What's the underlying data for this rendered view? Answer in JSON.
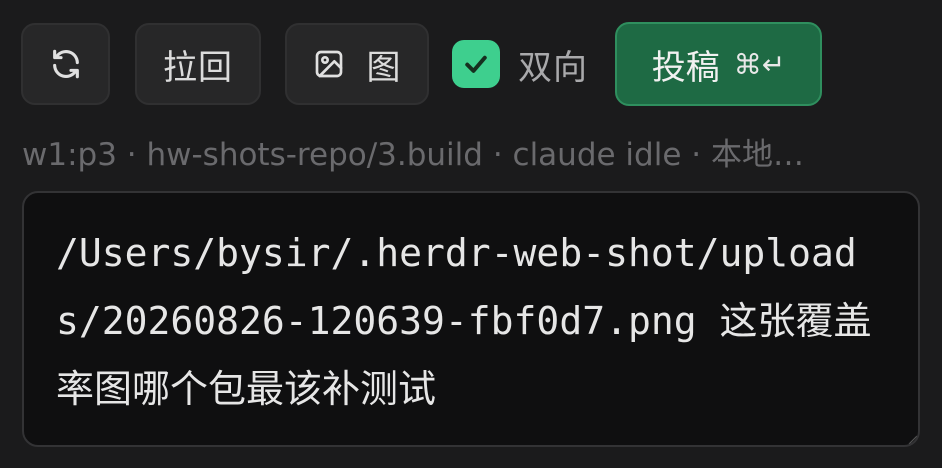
{
  "toolbar": {
    "refresh_icon": "refresh-icon",
    "pull_label": "拉回",
    "image_icon": "image-icon",
    "image_label": "图",
    "bidirectional_checked": true,
    "bidirectional_label": "双向",
    "submit_label": "投稿",
    "submit_shortcut": "⌘↵"
  },
  "status": {
    "text": "w1:p3 · hw-shots-repo/3.build · claude idle · 本地…"
  },
  "composer": {
    "value": "/Users/bysir/.herdr-web-shot/uploads/20260826-120639-fbf0d7.png 这张覆盖率图哪个包最该补测试"
  },
  "colors": {
    "accent": "#3ecf8e",
    "submit_bg": "#1e6a44",
    "background": "#1b1b1c"
  }
}
